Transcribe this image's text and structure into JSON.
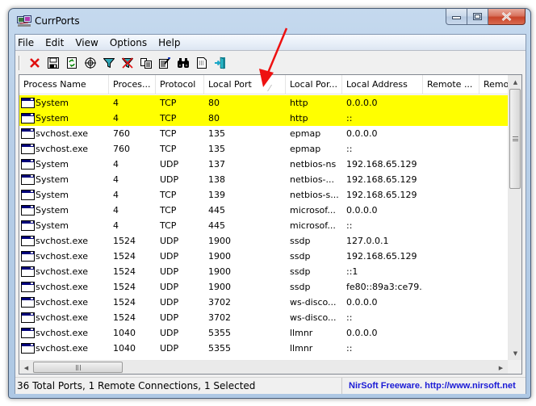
{
  "window": {
    "title": "CurrPorts",
    "icon": "currports-app-icon",
    "caption_buttons": [
      "minimize",
      "maximize",
      "close"
    ]
  },
  "menu": [
    "File",
    "Edit",
    "View",
    "Options",
    "Help"
  ],
  "toolbar": [
    {
      "name": "close-connections-icon",
      "tooltip": "Close Selected TCP Connections"
    },
    {
      "name": "save-icon",
      "tooltip": "Save Selected Items"
    },
    {
      "name": "refresh-icon",
      "tooltip": "Refresh"
    },
    {
      "name": "target-icon",
      "tooltip": "Properties"
    },
    {
      "name": "filter-icon",
      "tooltip": "Filter"
    },
    {
      "name": "clear-filter-icon",
      "tooltip": "Clear Filter"
    },
    {
      "name": "copy-icon",
      "tooltip": "Copy"
    },
    {
      "name": "properties-icon",
      "tooltip": "Properties"
    },
    {
      "name": "find-icon",
      "tooltip": "Find"
    },
    {
      "name": "html-report-icon",
      "tooltip": "HTML Report"
    },
    {
      "name": "exit-icon",
      "tooltip": "Exit"
    }
  ],
  "columns": [
    "Process Name",
    "Proces...",
    "Protocol",
    "Local Port",
    "Local Por...",
    "Local Address",
    "Remote ...",
    "Remo"
  ],
  "sorted_column_indicator": "Local Port",
  "rows": [
    {
      "process": "System",
      "pid": "4",
      "protocol": "TCP",
      "local_port": "80",
      "port_name": "http",
      "local_address": "0.0.0.0",
      "remote_port": "",
      "remote_address": "",
      "highlight": true
    },
    {
      "process": "System",
      "pid": "4",
      "protocol": "TCP",
      "local_port": "80",
      "port_name": "http",
      "local_address": "::",
      "remote_port": "",
      "remote_address": "",
      "highlight": true
    },
    {
      "process": "svchost.exe",
      "pid": "760",
      "protocol": "TCP",
      "local_port": "135",
      "port_name": "epmap",
      "local_address": "0.0.0.0",
      "remote_port": "",
      "remote_address": "",
      "highlight": false
    },
    {
      "process": "svchost.exe",
      "pid": "760",
      "protocol": "TCP",
      "local_port": "135",
      "port_name": "epmap",
      "local_address": "::",
      "remote_port": "",
      "remote_address": "",
      "highlight": false
    },
    {
      "process": "System",
      "pid": "4",
      "protocol": "UDP",
      "local_port": "137",
      "port_name": "netbios-ns",
      "local_address": "192.168.65.129",
      "remote_port": "",
      "remote_address": "",
      "highlight": false
    },
    {
      "process": "System",
      "pid": "4",
      "protocol": "UDP",
      "local_port": "138",
      "port_name": "netbios-...",
      "local_address": "192.168.65.129",
      "remote_port": "",
      "remote_address": "",
      "highlight": false
    },
    {
      "process": "System",
      "pid": "4",
      "protocol": "TCP",
      "local_port": "139",
      "port_name": "netbios-s...",
      "local_address": "192.168.65.129",
      "remote_port": "",
      "remote_address": "",
      "highlight": false
    },
    {
      "process": "System",
      "pid": "4",
      "protocol": "TCP",
      "local_port": "445",
      "port_name": "microsof...",
      "local_address": "0.0.0.0",
      "remote_port": "",
      "remote_address": "",
      "highlight": false
    },
    {
      "process": "System",
      "pid": "4",
      "protocol": "TCP",
      "local_port": "445",
      "port_name": "microsof...",
      "local_address": "::",
      "remote_port": "",
      "remote_address": "",
      "highlight": false
    },
    {
      "process": "svchost.exe",
      "pid": "1524",
      "protocol": "UDP",
      "local_port": "1900",
      "port_name": "ssdp",
      "local_address": "127.0.0.1",
      "remote_port": "",
      "remote_address": "",
      "highlight": false
    },
    {
      "process": "svchost.exe",
      "pid": "1524",
      "protocol": "UDP",
      "local_port": "1900",
      "port_name": "ssdp",
      "local_address": "192.168.65.129",
      "remote_port": "",
      "remote_address": "",
      "highlight": false
    },
    {
      "process": "svchost.exe",
      "pid": "1524",
      "protocol": "UDP",
      "local_port": "1900",
      "port_name": "ssdp",
      "local_address": "::1",
      "remote_port": "",
      "remote_address": "",
      "highlight": false
    },
    {
      "process": "svchost.exe",
      "pid": "1524",
      "protocol": "UDP",
      "local_port": "1900",
      "port_name": "ssdp",
      "local_address": "fe80::89a3:ce79...",
      "remote_port": "",
      "remote_address": "",
      "highlight": false
    },
    {
      "process": "svchost.exe",
      "pid": "1524",
      "protocol": "UDP",
      "local_port": "3702",
      "port_name": "ws-disco...",
      "local_address": "0.0.0.0",
      "remote_port": "",
      "remote_address": "",
      "highlight": false
    },
    {
      "process": "svchost.exe",
      "pid": "1524",
      "protocol": "UDP",
      "local_port": "3702",
      "port_name": "ws-disco...",
      "local_address": "::",
      "remote_port": "",
      "remote_address": "",
      "highlight": false
    },
    {
      "process": "svchost.exe",
      "pid": "1040",
      "protocol": "UDP",
      "local_port": "5355",
      "port_name": "llmnr",
      "local_address": "0.0.0.0",
      "remote_port": "",
      "remote_address": "",
      "highlight": false
    },
    {
      "process": "svchost.exe",
      "pid": "1040",
      "protocol": "UDP",
      "local_port": "5355",
      "port_name": "llmnr",
      "local_address": "::",
      "remote_port": "",
      "remote_address": "",
      "highlight": false
    }
  ],
  "colors": {
    "highlight_row": "#ffff00",
    "status_link": "#1b1bd6",
    "annotation_arrow": "#ee1111"
  },
  "status": {
    "summary": "36 Total Ports, 1 Remote Connections, 1 Selected",
    "credit": "NirSoft Freeware.  http://www.nirsoft.net"
  }
}
